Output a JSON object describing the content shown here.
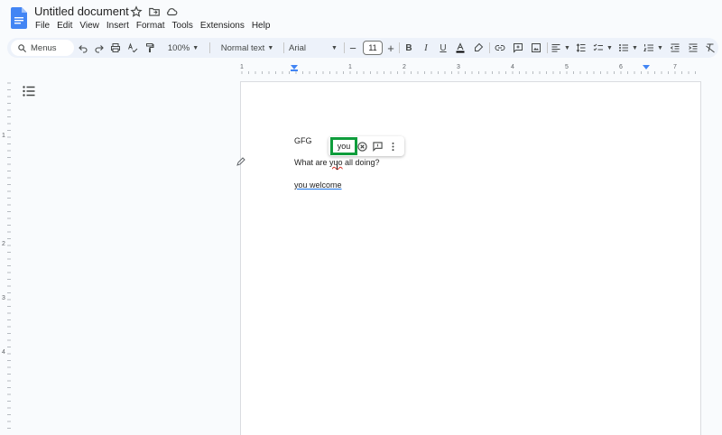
{
  "app": {
    "title": "Untitled document",
    "icons": [
      "docs-logo-icon",
      "star-icon",
      "move-folder-icon",
      "cloud-saved-icon"
    ]
  },
  "menubar": [
    "File",
    "Edit",
    "View",
    "Insert",
    "Format",
    "Tools",
    "Extensions",
    "Help"
  ],
  "toolbar": {
    "menus_label": "Menus",
    "zoom": "100%",
    "style": "Normal text",
    "font": "Arial",
    "font_size": "11",
    "icons": [
      "search-icon",
      "undo-icon",
      "redo-icon",
      "print-icon",
      "spellcheck-icon",
      "paint-format-icon",
      "decrease-font-icon",
      "increase-font-icon",
      "bold-icon",
      "italic-icon",
      "underline-icon",
      "text-color-icon",
      "highlight-icon",
      "link-icon",
      "comment-icon",
      "image-icon",
      "align-icon",
      "line-spacing-icon",
      "checklist-icon",
      "bullet-list-icon",
      "numbered-list-icon",
      "decrease-indent-icon",
      "increase-indent-icon",
      "clear-format-icon"
    ]
  },
  "ruler": {
    "top_labels": [
      "1",
      "1",
      "2",
      "3",
      "4",
      "5",
      "6",
      "7"
    ],
    "left_labels": [
      "1",
      "2",
      "3",
      "4"
    ]
  },
  "document": {
    "lines": [
      "GFG",
      "What are ",
      "yuo",
      " all doing?",
      "you welcome"
    ],
    "misspelled_word": "yuo"
  },
  "suggestion_popup": {
    "suggestion": "you",
    "icons": [
      "dismiss-icon",
      "comment-icon",
      "more-options-icon"
    ]
  },
  "colors": {
    "accent_blue": "#1a73e8",
    "highlight_green": "#0f9d3c",
    "spell_red": "#d93025"
  }
}
